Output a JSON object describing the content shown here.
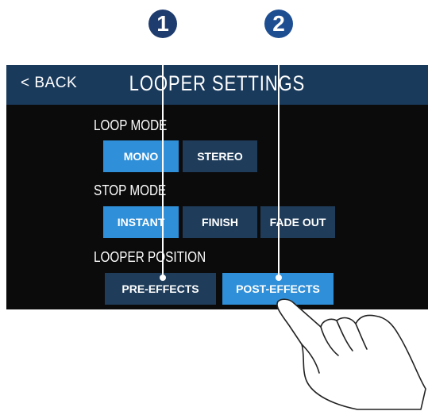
{
  "header": {
    "back_label": "< BACK",
    "title": "LOOPER SETTINGS"
  },
  "loop_mode": {
    "label": "LOOP MODE",
    "options": [
      {
        "label": "MONO",
        "selected": true
      },
      {
        "label": "STEREO",
        "selected": false
      }
    ]
  },
  "stop_mode": {
    "label": "STOP MODE",
    "options": [
      {
        "label": "INSTANT",
        "selected": true
      },
      {
        "label": "FINISH",
        "selected": false
      },
      {
        "label": "FADE OUT",
        "selected": false
      }
    ]
  },
  "looper_position": {
    "label": "LOOPER POSITION",
    "options": [
      {
        "label": "PRE-EFFECTS",
        "selected": false
      },
      {
        "label": "POST-EFFECTS",
        "selected": true
      }
    ]
  },
  "callouts": [
    "1",
    "2"
  ],
  "colors": {
    "header_bg": "#1a3a5c",
    "screen_bg": "#0b0b0b",
    "button_selected": "#2f8fd8",
    "button_unselected": "#1f3c5a",
    "callout_1": "#1f3c6e",
    "callout_2": "#1e4e92"
  }
}
